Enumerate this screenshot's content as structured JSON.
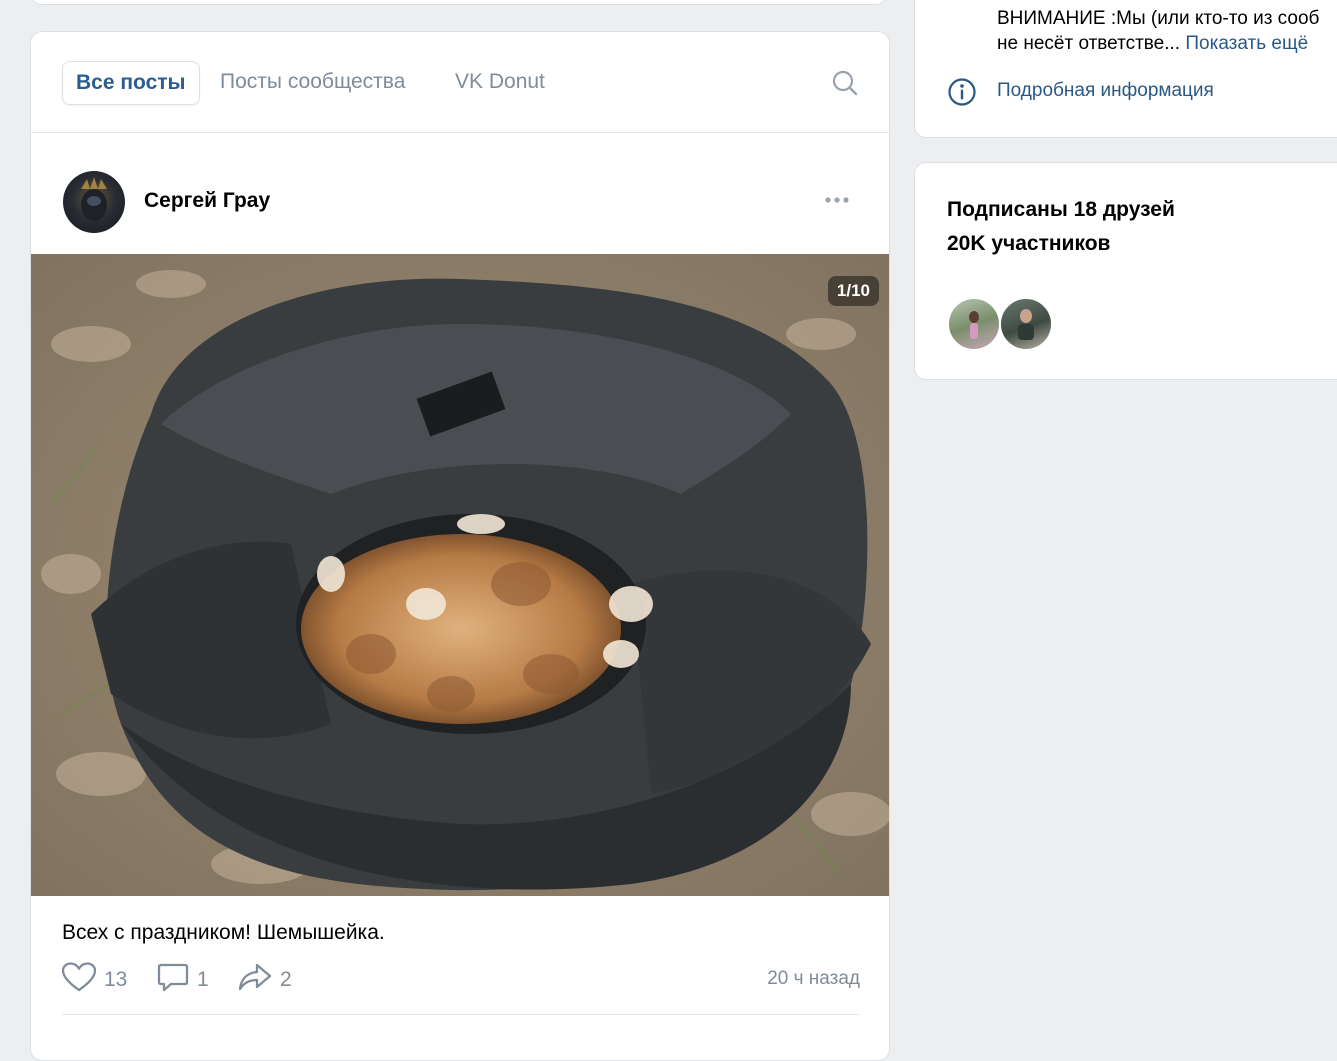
{
  "tabs": {
    "all": "Все посты",
    "community": "Посты сообщества",
    "donut": "VK Donut"
  },
  "post": {
    "author": "Сергей Грау",
    "photo_counter": "1/10",
    "text": "Всех с праздником! Шемышейка.",
    "likes": "13",
    "comments": "1",
    "shares": "2",
    "time": "20 ч назад"
  },
  "sidebar": {
    "warning_text": "ВНИМАНИЕ :Мы (или кто-то из сооб",
    "warning_text_line2": "не несёт ответстве...",
    "show_more": "Показать ещё",
    "more_info": "Подробная информация",
    "friends_subscribed": "Подписаны 18 друзей",
    "members_count": "20K участников"
  },
  "icons": {
    "search": "search-icon",
    "more": "more-dots-icon",
    "like": "heart-icon",
    "comment": "comment-icon",
    "share": "share-icon",
    "info": "info-icon"
  },
  "colors": {
    "background": "#edeef0",
    "accent": "#2c5d8f",
    "link": "#2a5885",
    "secondary_text": "#818c99"
  }
}
